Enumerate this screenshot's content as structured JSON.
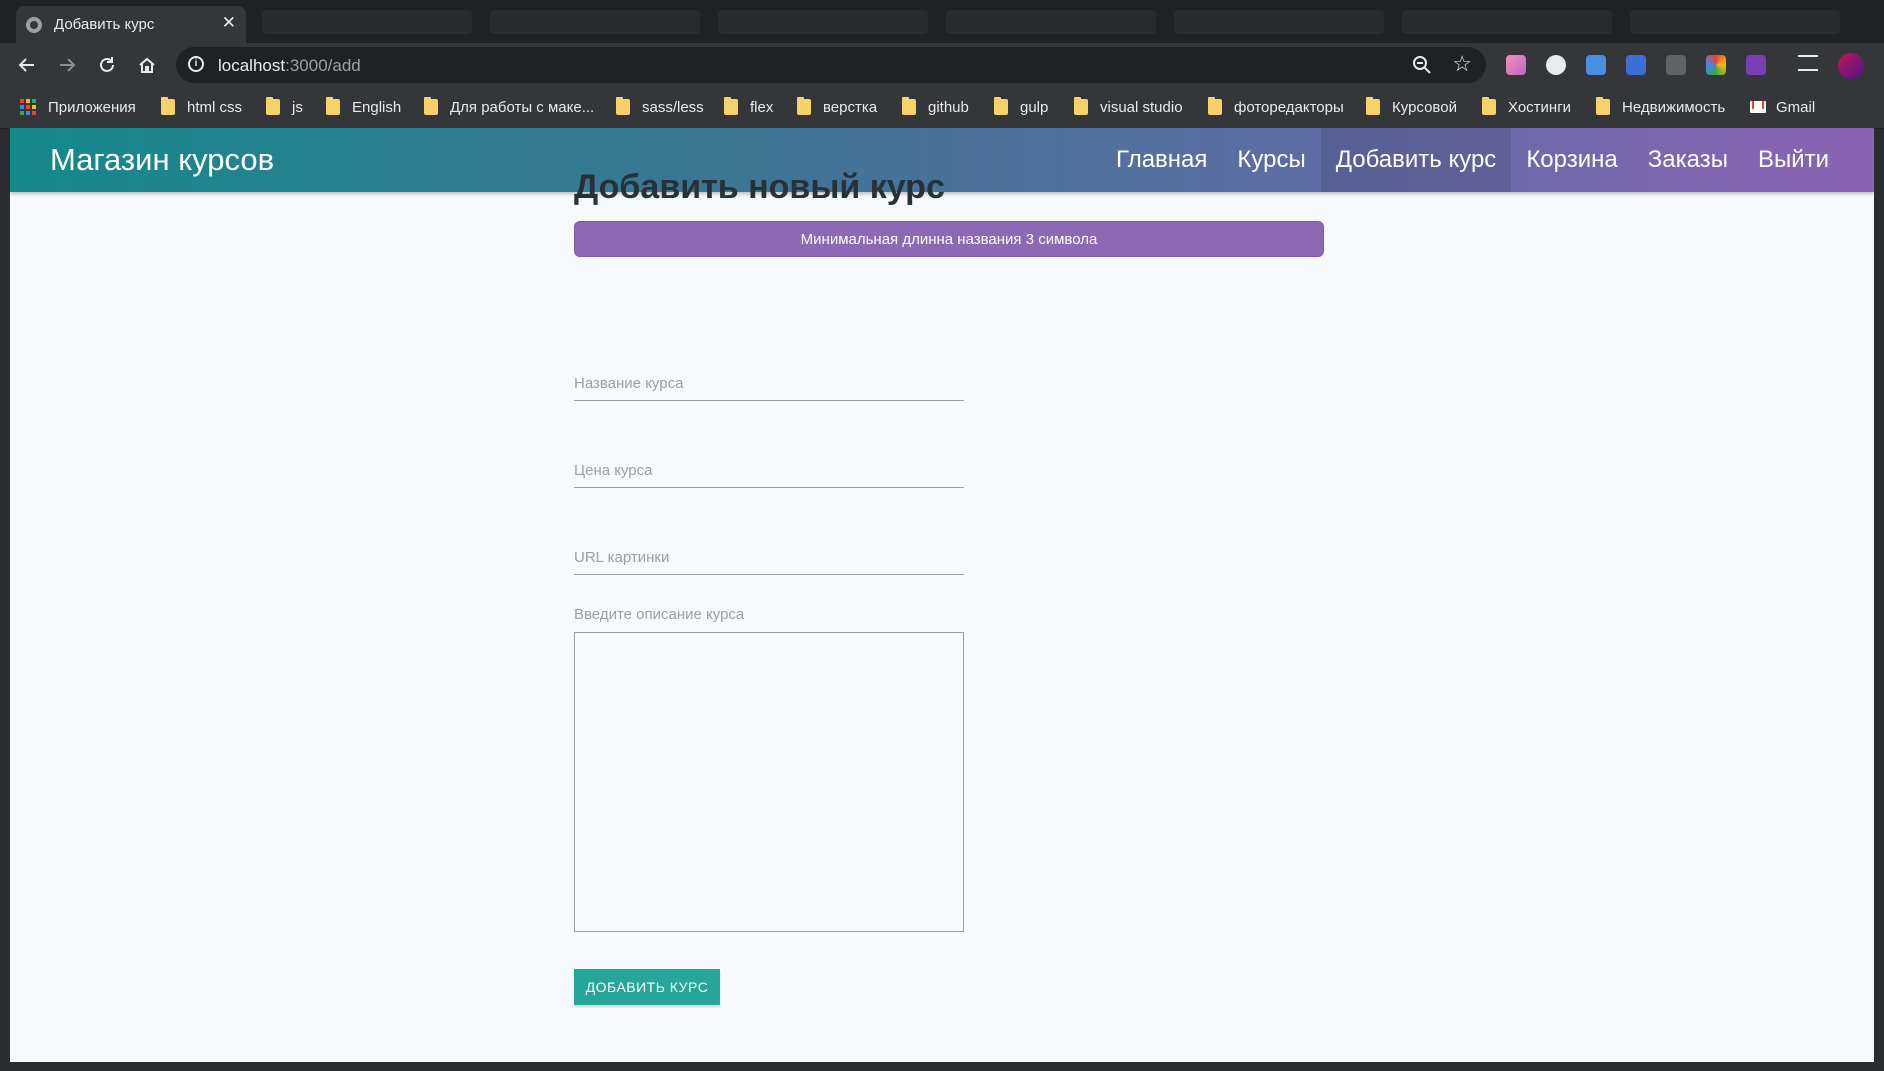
{
  "browser": {
    "tab_title": "Добавить курс",
    "tab_close": "✕",
    "url_host": "localhost",
    "url_path": ":3000/add",
    "bookmarks": [
      {
        "label": "Приложения",
        "icon": "apps-icon"
      },
      {
        "label": "html css",
        "icon": "folder-icon"
      },
      {
        "label": "js",
        "icon": "folder-icon"
      },
      {
        "label": "English",
        "icon": "folder-icon"
      },
      {
        "label": "Для работы с маке...",
        "icon": "folder-icon"
      },
      {
        "label": "sass/less",
        "icon": "folder-icon"
      },
      {
        "label": "flex",
        "icon": "folder-icon"
      },
      {
        "label": "верстка",
        "icon": "folder-icon"
      },
      {
        "label": "github",
        "icon": "folder-icon"
      },
      {
        "label": "gulp",
        "icon": "folder-icon"
      },
      {
        "label": "visual studio",
        "icon": "folder-icon"
      },
      {
        "label": "фоторедакторы",
        "icon": "folder-icon"
      },
      {
        "label": "Курсовой",
        "icon": "folder-icon"
      },
      {
        "label": "Хостинги",
        "icon": "folder-icon"
      },
      {
        "label": "Недвижимость",
        "icon": "folder-icon"
      },
      {
        "label": "Gmail",
        "icon": "gmail-icon"
      }
    ]
  },
  "navbar": {
    "brand": "Магазин курсов",
    "links": [
      {
        "label": "Главная",
        "active": false
      },
      {
        "label": "Курсы",
        "active": false
      },
      {
        "label": "Добавить курс",
        "active": true
      },
      {
        "label": "Корзина",
        "active": false
      },
      {
        "label": "Заказы",
        "active": false
      },
      {
        "label": "Выйти",
        "active": false
      }
    ]
  },
  "form": {
    "title": "Добавить новый курс",
    "alert": "Минимальная длинна названия 3 символа",
    "title_placeholder": "Название курса",
    "price_placeholder": "Цена курса",
    "img_placeholder": "URL картинки",
    "title_value": "",
    "price_value": "",
    "img_value": "",
    "description_label": "Введите описание курса",
    "description_value": "",
    "submit": "ДОБАВИТЬ КУРС"
  },
  "colors": {
    "navbar_start": "#14898a",
    "navbar_end": "#8c63b4",
    "alert": "#8e67b5",
    "submit_button": "#26a69a",
    "page_background": "#f7fafc"
  }
}
